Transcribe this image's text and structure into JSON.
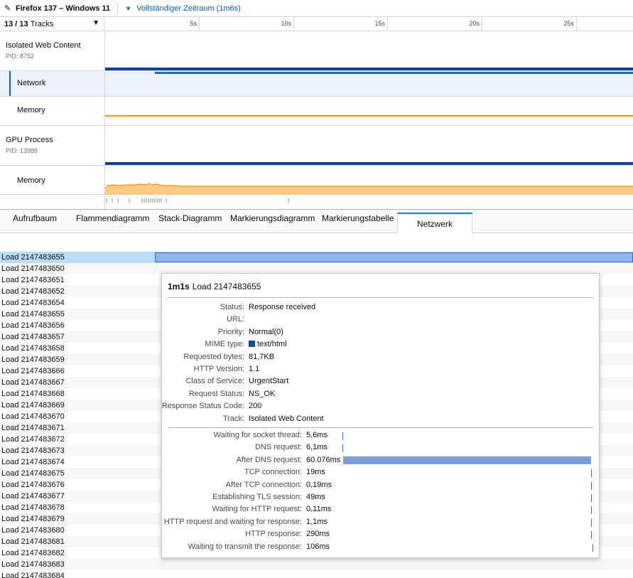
{
  "topbar": {
    "app_title": "Firefox 137 – Windows 11",
    "range_label": "Vollständiger Zeitraum (1m6s)"
  },
  "timeline": {
    "track_count_selected": "13",
    "track_count_total": "13",
    "track_count_suffix": "Tracks",
    "ticks": [
      "5s",
      "10s",
      "15s",
      "20s",
      "25s"
    ],
    "tracks": {
      "isolated": {
        "name": "Isolated Web Content",
        "pid": "PID: 8752"
      },
      "network": {
        "name": "Network"
      },
      "memory1": {
        "name": "Memory"
      },
      "gpu": {
        "name": "GPU Process",
        "pid": "PID: 13988"
      },
      "memory2": {
        "name": "Memory"
      }
    },
    "colors": {
      "network": "#0b3fa8",
      "memory": "#ff9400",
      "memory_fill": "#ffcb84"
    }
  },
  "tabs": {
    "t1": "Aufrufbaum",
    "t2": "Flammendiagramm",
    "t3": "Stack-Diagramm",
    "t4": "Markierungsdiagramm",
    "t5": "Markierungstabelle",
    "t6": "Netzwerk"
  },
  "requests": [
    "Load 2147483655",
    "Load 2147483650",
    "Load 2147483651",
    "Load 2147483652",
    "Load 2147483654",
    "Load 2147483655",
    "Load 2147483656",
    "Load 2147483657",
    "Load 2147483658",
    "Load 2147483659",
    "Load 2147483666",
    "Load 2147483667",
    "Load 2147483668",
    "Load 2147483669",
    "Load 2147483670",
    "Load 2147483671",
    "Load 2147483672",
    "Load 2147483673",
    "Load 2147483674",
    "Load 2147483675",
    "Load 2147483676",
    "Load 2147483677",
    "Load 2147483678",
    "Load 2147483679",
    "Load 2147483680",
    "Load 2147483681",
    "Load 2147483682",
    "Load 2147483683",
    "Load 2147483684"
  ],
  "tooltip": {
    "duration": "1m1s",
    "title": "Load 2147483655",
    "details": {
      "status_label": "Status:",
      "status": "Response received",
      "url_label": "URL:",
      "url": "",
      "priority_label": "Priority:",
      "priority": "Normal(0)",
      "mime_label": "MIME type:",
      "mime": "text/html",
      "bytes_label": "Requested bytes:",
      "bytes": "81,7KB",
      "http_label": "HTTP Version:",
      "http": "1.1",
      "cos_label": "Class of Service:",
      "cos": "UrgentStart",
      "reqstatus_label": "Request Status:",
      "reqstatus": "NS_OK",
      "code_label": "Response Status Code:",
      "code": "200",
      "track_label": "Track:",
      "track": "Isolated Web Content"
    },
    "phases": [
      {
        "label": "Waiting for socket thread:",
        "value": "5,6ms",
        "fraction": 0.0
      },
      {
        "label": "DNS request:",
        "value": "6,1ms",
        "fraction": 0.0
      },
      {
        "label": "After DNS request:",
        "value": "60.076ms",
        "fraction": 1.0
      },
      {
        "label": "TCP connection:",
        "value": "19ms",
        "fraction": 0.0
      },
      {
        "label": "After TCP connection:",
        "value": "0,19ms",
        "fraction": 0.0
      },
      {
        "label": "Establishing TLS session:",
        "value": "49ms",
        "fraction": 0.0
      },
      {
        "label": "Waiting for HTTP request:",
        "value": "0,11ms",
        "fraction": 0.0
      },
      {
        "label": "HTTP request and waiting for response:",
        "value": "1,1ms",
        "fraction": 0.0
      },
      {
        "label": "HTTP response:",
        "value": "290ms",
        "fraction": 0.0
      },
      {
        "label": "Waiting to transmit the response:",
        "value": "106ms",
        "fraction": 0.0
      }
    ]
  }
}
